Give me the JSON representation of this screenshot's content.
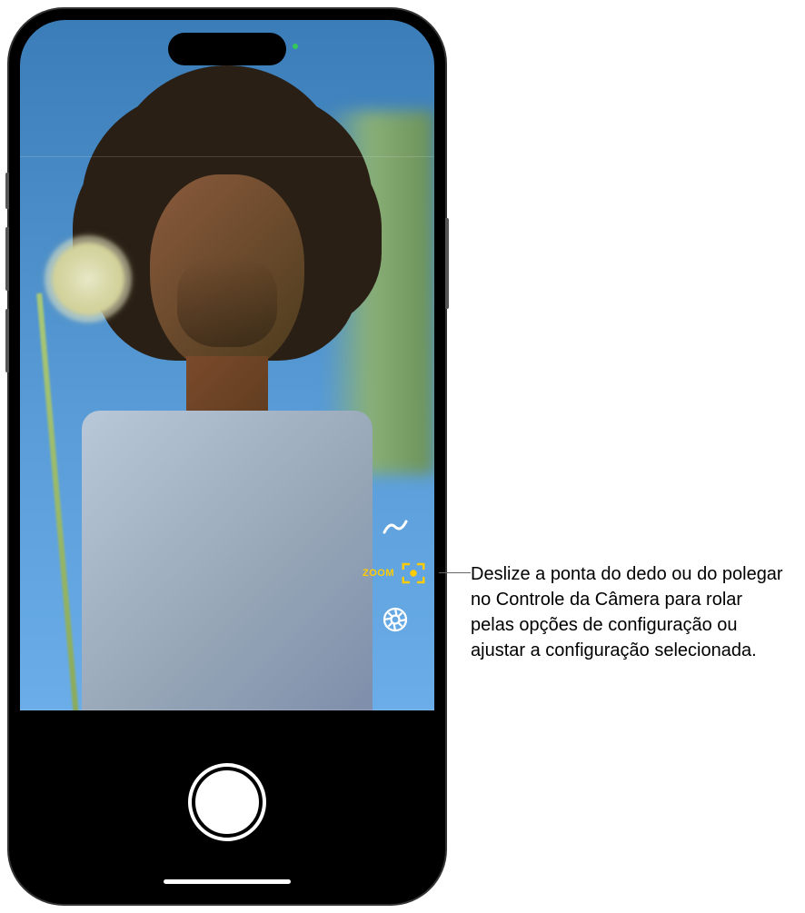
{
  "camera": {
    "zoom_label": "ZOOM",
    "controls": {
      "exposure": "exposure",
      "focus_frame": "focus-frame",
      "styles": "photographic-styles"
    }
  },
  "callout": {
    "text": "Deslize a ponta do dedo ou do polegar no Controle da Câmera para rolar pelas opções de configuração ou ajustar a configuração selecionada."
  },
  "colors": {
    "accent": "#ffcc00",
    "indicator_green": "#34c759"
  }
}
